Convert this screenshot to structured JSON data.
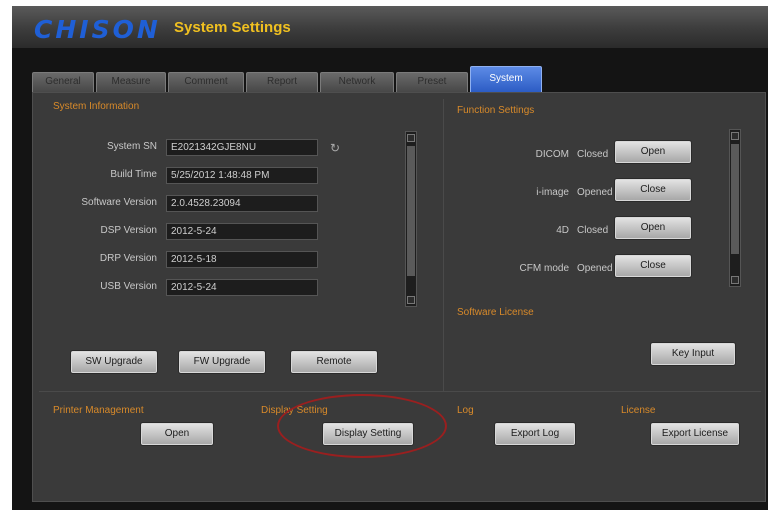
{
  "header": {
    "logo": "CHISON",
    "title": "System Settings"
  },
  "tabs": [
    "General",
    "Measure",
    "Comment",
    "Report",
    "Network",
    "Preset",
    "System"
  ],
  "active_tab": "System",
  "system_information": {
    "title": "System Information",
    "rows": [
      {
        "label": "System SN",
        "value": "E2021342GJE8NU"
      },
      {
        "label": "Build Time",
        "value": "5/25/2012 1:48:48 PM"
      },
      {
        "label": "Software Version",
        "value": "2.0.4528.23094"
      },
      {
        "label": "DSP Version",
        "value": "2012-5-24"
      },
      {
        "label": "DRP Version",
        "value": "2012-5-18"
      },
      {
        "label": "USB Version",
        "value": "2012-5-24"
      }
    ],
    "buttons": {
      "sw_upgrade": "SW Upgrade",
      "fw_upgrade": "FW Upgrade",
      "remote": "Remote"
    }
  },
  "function_settings": {
    "title": "Function Settings",
    "rows": [
      {
        "label": "DICOM",
        "status": "Closed",
        "button": "Open"
      },
      {
        "label": "i-image",
        "status": "Opened",
        "button": "Close"
      },
      {
        "label": "4D",
        "status": "Closed",
        "button": "Open"
      },
      {
        "label": "CFM mode",
        "status": "Opened",
        "button": "Close"
      }
    ]
  },
  "software_license": {
    "title": "Software License",
    "button": "Key Input"
  },
  "bottom": {
    "printer_management": {
      "title": "Printer Management",
      "button": "Open"
    },
    "display_setting": {
      "title": "Display Setting",
      "button": "Display Setting"
    },
    "log": {
      "title": "Log",
      "button": "Export Log"
    },
    "license": {
      "title": "License",
      "button": "Export License"
    }
  },
  "colors": {
    "section_title": "#d88a2a",
    "active_tab": "#2c5cc4",
    "title": "#f0c020",
    "logo": "#1f5fd6"
  }
}
